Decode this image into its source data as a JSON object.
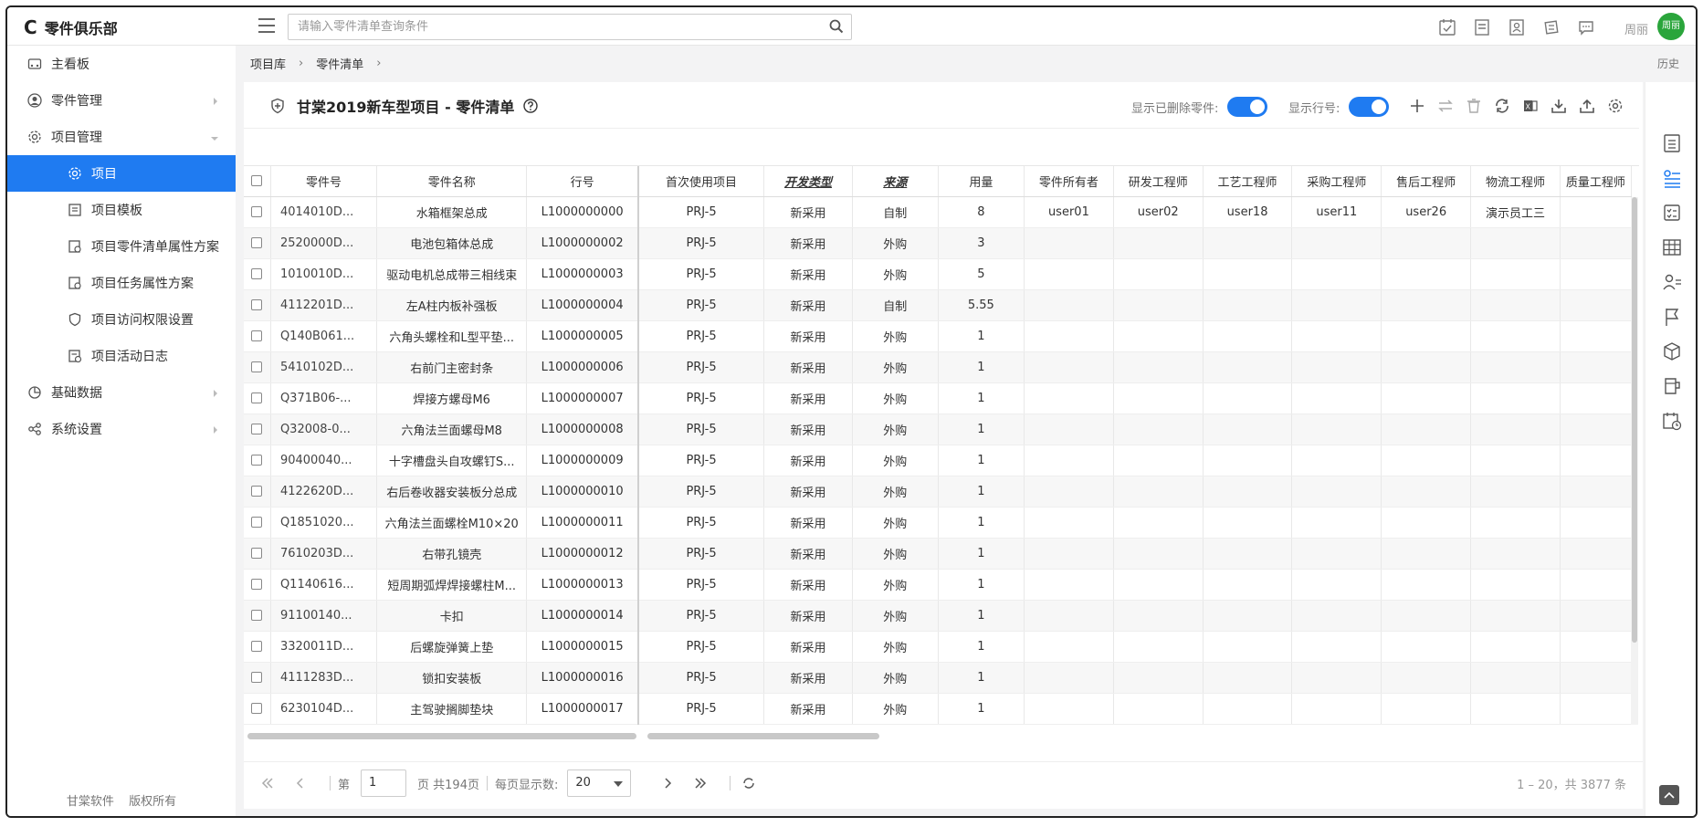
{
  "app": {
    "logo_mark": "C",
    "name": "零件俱乐部"
  },
  "header": {
    "search_placeholder": "请输入零件清单查询条件",
    "icons": [
      "calendar-check-icon",
      "document-icon",
      "contact-card-icon",
      "edit-doc-icon",
      "message-icon"
    ],
    "user_name": "周丽",
    "avatar_text": "周丽",
    "avatar_color": "#2aa53b"
  },
  "sidebar": {
    "items": [
      {
        "label": "主看板",
        "icon": "dashboard-icon",
        "level": 1
      },
      {
        "label": "零件管理",
        "icon": "user-circle-icon",
        "level": 1,
        "arrow": "right"
      },
      {
        "label": "项目管理",
        "icon": "gear-icon",
        "level": 1,
        "arrow": "down"
      },
      {
        "label": "项目",
        "icon": "gear-icon",
        "level": 2,
        "active": true
      },
      {
        "label": "项目模板",
        "icon": "template-icon",
        "level": 2
      },
      {
        "label": "项目零件清单属性方案",
        "icon": "attr-scheme-icon",
        "level": 2
      },
      {
        "label": "项目任务属性方案",
        "icon": "task-scheme-icon",
        "level": 2
      },
      {
        "label": "项目访问权限设置",
        "icon": "shield-icon",
        "level": 2
      },
      {
        "label": "项目活动日志",
        "icon": "log-icon",
        "level": 2
      },
      {
        "label": "基础数据",
        "icon": "pie-chart-icon",
        "level": 1,
        "arrow": "right"
      },
      {
        "label": "系统设置",
        "icon": "share-icon",
        "level": 1,
        "arrow": "right"
      }
    ],
    "footer": [
      "甘棠软件",
      "版权所有"
    ]
  },
  "breadcrumb": {
    "items": [
      "项目库",
      "零件清单"
    ],
    "history": "历史"
  },
  "card": {
    "title": "甘棠2019新车型项目 - 零件清单",
    "toggle_deleted_label": "显示已删除零件:",
    "toggle_rownum_label": "显示行号:",
    "accent": "#1f7bf1"
  },
  "table": {
    "headers": [
      "零件号",
      "零件名称",
      "行号",
      "首次使用项目",
      "开发类型",
      "来源",
      "用量",
      "零件所有者",
      "研发工程师",
      "工艺工程师",
      "采购工程师",
      "售后工程师",
      "物流工程师",
      "质量工程师"
    ],
    "rows": [
      [
        "4014010D...",
        "水箱框架总成",
        "L1000000000",
        "PRJ-5",
        "新采用",
        "自制",
        "8",
        "user01",
        "user02",
        "user18",
        "user11",
        "user26",
        "演示员工三",
        ""
      ],
      [
        "2520000D...",
        "电池包箱体总成",
        "L1000000002",
        "PRJ-5",
        "新采用",
        "外购",
        "3",
        "",
        "",
        "",
        "",
        "",
        "",
        ""
      ],
      [
        "1010010D...",
        "驱动电机总成带三相线束",
        "L1000000003",
        "PRJ-5",
        "新采用",
        "外购",
        "5",
        "",
        "",
        "",
        "",
        "",
        "",
        ""
      ],
      [
        "4112201D...",
        "左A柱内板补强板",
        "L1000000004",
        "PRJ-5",
        "新采用",
        "自制",
        "5.55",
        "",
        "",
        "",
        "",
        "",
        "",
        ""
      ],
      [
        "Q140B061...",
        "六角头螺栓和L型平垫...",
        "L1000000005",
        "PRJ-5",
        "新采用",
        "外购",
        "1",
        "",
        "",
        "",
        "",
        "",
        "",
        ""
      ],
      [
        "5410102D...",
        "右前门主密封条",
        "L1000000006",
        "PRJ-5",
        "新采用",
        "外购",
        "1",
        "",
        "",
        "",
        "",
        "",
        "",
        ""
      ],
      [
        "Q371B06-...",
        "焊接方螺母M6",
        "L1000000007",
        "PRJ-5",
        "新采用",
        "外购",
        "1",
        "",
        "",
        "",
        "",
        "",
        "",
        ""
      ],
      [
        "Q32008-0...",
        "六角法兰面螺母M8",
        "L1000000008",
        "PRJ-5",
        "新采用",
        "外购",
        "1",
        "",
        "",
        "",
        "",
        "",
        "",
        ""
      ],
      [
        "90400040...",
        "十字槽盘头自攻螺钉S...",
        "L1000000009",
        "PRJ-5",
        "新采用",
        "外购",
        "1",
        "",
        "",
        "",
        "",
        "",
        "",
        ""
      ],
      [
        "4122620D...",
        "右后卷收器安装板分总成",
        "L1000000010",
        "PRJ-5",
        "新采用",
        "外购",
        "1",
        "",
        "",
        "",
        "",
        "",
        "",
        ""
      ],
      [
        "Q1851020...",
        "六角法兰面螺栓M10×20",
        "L1000000011",
        "PRJ-5",
        "新采用",
        "外购",
        "1",
        "",
        "",
        "",
        "",
        "",
        "",
        ""
      ],
      [
        "7610203D...",
        "右带孔镜壳",
        "L1000000012",
        "PRJ-5",
        "新采用",
        "外购",
        "1",
        "",
        "",
        "",
        "",
        "",
        "",
        ""
      ],
      [
        "Q1140616...",
        "短周期弧焊焊接螺柱M...",
        "L1000000013",
        "PRJ-5",
        "新采用",
        "外购",
        "1",
        "",
        "",
        "",
        "",
        "",
        "",
        ""
      ],
      [
        "91100140...",
        "卡扣",
        "L1000000014",
        "PRJ-5",
        "新采用",
        "外购",
        "1",
        "",
        "",
        "",
        "",
        "",
        "",
        ""
      ],
      [
        "3320011D...",
        "后螺旋弹簧上垫",
        "L1000000015",
        "PRJ-5",
        "新采用",
        "外购",
        "1",
        "",
        "",
        "",
        "",
        "",
        "",
        ""
      ],
      [
        "4111283D...",
        "锁扣安装板",
        "L1000000016",
        "PRJ-5",
        "新采用",
        "外购",
        "1",
        "",
        "",
        "",
        "",
        "",
        "",
        ""
      ],
      [
        "6230104D...",
        "主驾驶搁脚垫块",
        "L1000000017",
        "PRJ-5",
        "新采用",
        "外购",
        "1",
        "",
        "",
        "",
        "",
        "",
        "",
        ""
      ]
    ]
  },
  "pager": {
    "page_prefix": "第",
    "page_value": "1",
    "page_suffix": "页 共194页",
    "page_size_label": "每页显示数:",
    "page_size": "20",
    "total": "1 – 20，共 3877 条"
  }
}
